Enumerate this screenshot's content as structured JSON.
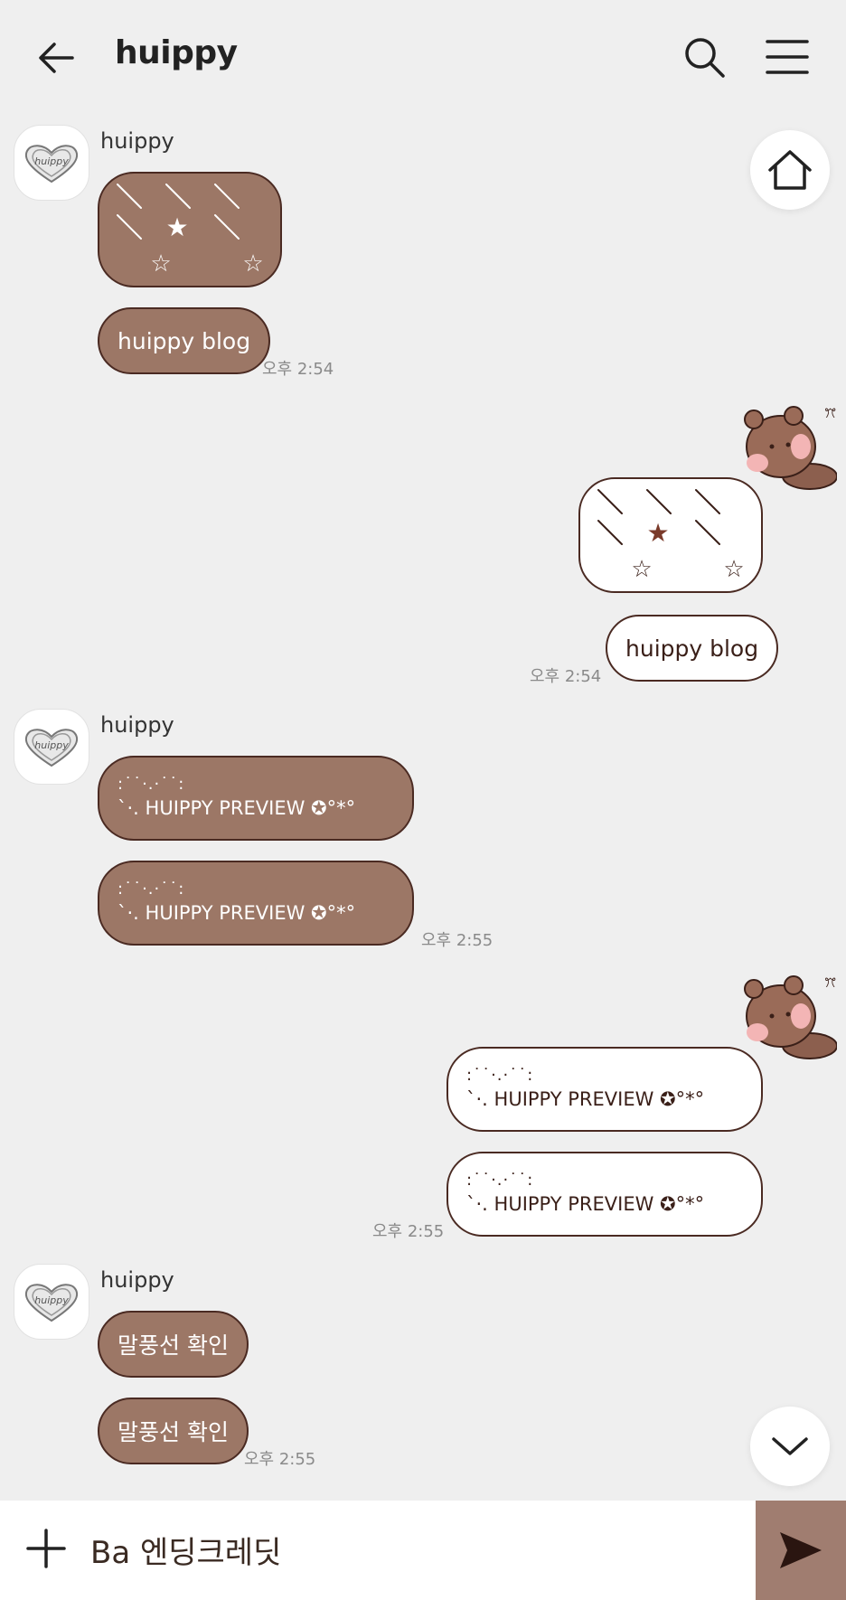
{
  "header": {
    "title": "huippy",
    "back_icon": "arrow-left-icon",
    "search_icon": "search-icon",
    "menu_icon": "hamburger-menu-icon"
  },
  "colors": {
    "background": "#efefef",
    "incoming_bubble": "#9c7766",
    "outgoing_bubble": "#ffffff",
    "bubble_border": "#4a2a22",
    "send_button": "#a07d70"
  },
  "avatar": {
    "logo_text": "huippy"
  },
  "messages": [
    {
      "sender": "huippy",
      "items": [
        {
          "type": "pattern"
        },
        {
          "type": "text",
          "text": "huippy blog"
        }
      ],
      "time": "오후 2:54"
    },
    {
      "direction": "outgoing",
      "items": [
        {
          "type": "pattern"
        },
        {
          "type": "text",
          "text": "huippy blog"
        }
      ],
      "time": "오후 2:54"
    },
    {
      "sender": "huippy",
      "items": [
        {
          "deco": ":˙˙·.·˙˙:",
          "text": "`·. HUIPPY PREVIEW ✪°*°"
        },
        {
          "deco": ":˙˙·.·˙˙:",
          "text": "`·. HUIPPY PREVIEW ✪°*°"
        }
      ],
      "time": "오후 2:55"
    },
    {
      "direction": "outgoing",
      "items": [
        {
          "deco": ":˙˙·.·˙˙:",
          "text": "`·. HUIPPY PREVIEW ✪°*°"
        },
        {
          "deco": ":˙˙·.·˙˙:",
          "text": "`·. HUIPPY PREVIEW ✪°*°"
        }
      ],
      "time": "오후 2:55"
    },
    {
      "sender": "huippy",
      "items": [
        {
          "type": "text",
          "text": "말풍선 확인"
        },
        {
          "type": "text",
          "text": "말풍선 확인"
        }
      ],
      "time": "오후 2:55"
    }
  ],
  "floating": {
    "home_icon": "home-icon",
    "scroll_down_icon": "chevron-down-icon"
  },
  "input": {
    "value": "Ba 엔딩크레딧",
    "plus_icon": "plus-icon",
    "send_icon": "send-icon"
  }
}
